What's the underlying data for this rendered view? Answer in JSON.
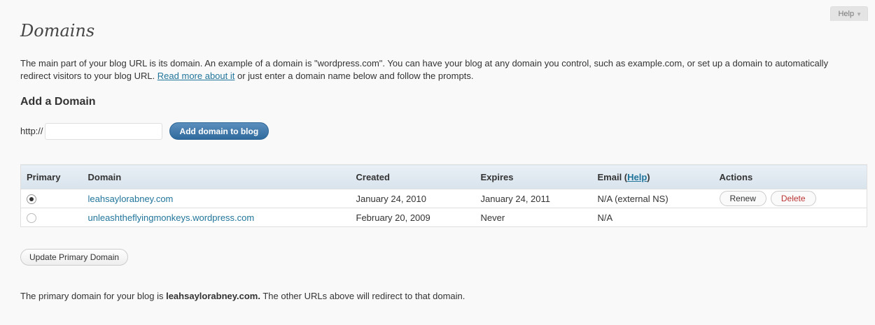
{
  "help": {
    "label": "Help"
  },
  "page": {
    "title": "Domains"
  },
  "intro": {
    "text_before": "The main part of your blog URL is its domain. An example of a domain is \"wordpress.com\". You can have your blog at any domain you control, such as example.com, or set up a domain to automatically redirect visitors to your blog URL. ",
    "link": "Read more about it",
    "text_after": " or just enter a domain name below and follow the prompts."
  },
  "add_domain": {
    "title": "Add a Domain",
    "prefix": "http://",
    "input_value": "",
    "button": "Add domain to blog"
  },
  "table": {
    "headers": {
      "primary": "Primary",
      "domain": "Domain",
      "created": "Created",
      "expires": "Expires",
      "email": "Email (",
      "email_help": "Help",
      "email_close": ")",
      "actions": "Actions"
    },
    "rows": [
      {
        "primary": true,
        "domain": "leahsaylorabney.com",
        "created": "January 24, 2010",
        "expires": "January 24, 2011",
        "email": "N/A (external NS)",
        "renew": "Renew",
        "delete": "Delete"
      },
      {
        "primary": false,
        "domain": "unleashtheflyingmonkeys.wordpress.com",
        "created": "February 20, 2009",
        "expires": "Never",
        "email": "N/A"
      }
    ]
  },
  "update_button": "Update Primary Domain",
  "footer": {
    "before": "The primary domain for your blog is ",
    "domain": "leahsaylorabney.com.",
    "after": " The other URLs above will redirect to that domain."
  },
  "colors": {
    "accent": "#21759b",
    "primary_button": "#3f76a8",
    "table_header": "#dfe8f0"
  }
}
